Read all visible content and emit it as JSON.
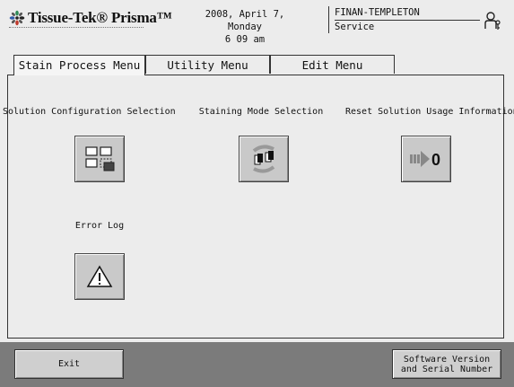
{
  "header": {
    "logo_text": "Tissue-Tek® Prisma™",
    "date_line": "2008, April 7, Monday",
    "time_line": "6 09 am",
    "user_name": "FINAN-TEMPLETON",
    "user_role": "Service"
  },
  "tabs": [
    {
      "label": "Stain Process Menu",
      "active": true
    },
    {
      "label": "Utility Menu",
      "active": false
    },
    {
      "label": "Edit Menu",
      "active": false
    }
  ],
  "functions": {
    "solution_config": "Solution Configuration Selection",
    "staining_mode": "Staining Mode Selection",
    "reset_usage": "Reset Solution Usage Information",
    "reset_value": "0",
    "error_log": "Error Log"
  },
  "footer": {
    "exit_label": "Exit",
    "software_line1": "Software Version",
    "software_line2": "and Serial Number"
  },
  "colors": {
    "background": "#ececec",
    "button_face": "#c9c9c9",
    "footer_bar": "#7b7b7b",
    "logo_green": "#2e8b57",
    "logo_red": "#c0392b",
    "logo_blue": "#2f5aa8"
  },
  "icons": {
    "logo": "tissue-tek-star-icon",
    "user": "user-key-icon",
    "solution": "grid-config-icon",
    "staining": "slide-rotate-icon",
    "reset": "arrow-zero-icon",
    "error": "warning-triangle-icon"
  }
}
